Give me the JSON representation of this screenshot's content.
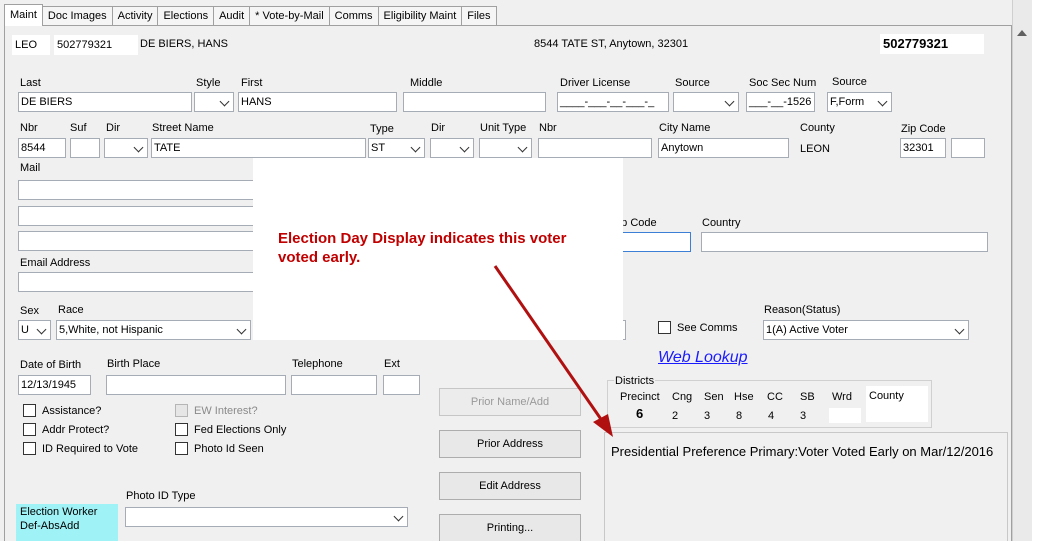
{
  "tabs": [
    "Maint",
    "Doc Images",
    "Activity",
    "Elections",
    "Audit",
    "* Vote-by-Mail",
    "Comms",
    "Eligibility Maint",
    "Files"
  ],
  "header": {
    "county_code": "LEO",
    "voter_id": "502779321",
    "name": "DE BIERS, HANS",
    "address": "8544 TATE ST, Anytown, 32301",
    "voter_id_right": "502779321"
  },
  "name_row": {
    "last_label": "Last",
    "last_value": "DE BIERS",
    "style_label": "Style",
    "style_value": "",
    "first_label": "First",
    "first_value": "HANS",
    "middle_label": "Middle",
    "middle_value": "",
    "dl_label": "Driver License",
    "dl_value": "____-___-__-___-_",
    "source_label": "Source",
    "source_value": "",
    "ssn_label": "Soc Sec Num",
    "ssn_value": "___-__-1526",
    "source2_label": "Source",
    "source2_value": "F,Form"
  },
  "addr_row": {
    "nbr_label": "Nbr",
    "nbr_value": "8544",
    "suf_label": "Suf",
    "suf_value": "",
    "dir_label": "Dir",
    "dir_value": "",
    "street_label": "Street Name",
    "street_value": "TATE",
    "type_label": "Type",
    "type_value": "ST",
    "dir2_label": "Dir",
    "dir2_value": "",
    "unit_label": "Unit Type",
    "unit_value": "",
    "nbr2_label": "Nbr",
    "nbr2_value": "",
    "city_label": "City Name",
    "city_value": "Anytown",
    "county_label": "County",
    "county_value": "LEON",
    "zip_label": "Zip Code",
    "zip_value": "32301",
    "zip_ext": ""
  },
  "mail": {
    "label": "Mail",
    "zip_label": "Zip Code",
    "country_label": "Country"
  },
  "email_label": "Email Address",
  "demo": {
    "sex_label": "Sex",
    "sex_value": "U",
    "race_label": "Race",
    "race_value": "5,White, not Hispanic",
    "see_comms": "See Comms",
    "reason_label": "Reason(Status)",
    "reason_value": "1(A) Active Voter"
  },
  "web_lookup": "Web Lookup",
  "birth": {
    "dob_label": "Date of Birth",
    "dob_value": "12/13/1945",
    "place_label": "Birth Place",
    "place_value": "",
    "tel_label": "Telephone",
    "tel_value": "",
    "ext_label": "Ext",
    "ext_value": ""
  },
  "districts": {
    "label": "Districts",
    "headers": [
      "Precinct",
      "Cng",
      "Sen",
      "Hse",
      "CC",
      "SB",
      "Wrd"
    ],
    "values": [
      "6",
      "2",
      "3",
      "8",
      "4",
      "3",
      ""
    ],
    "county_label": "County"
  },
  "checkboxes": {
    "assistance": "Assistance?",
    "addr_protect": "Addr Protect?",
    "id_required": "ID Required to Vote",
    "ew_interest": "EW Interest?",
    "fed_only": "Fed Elections Only",
    "photo_seen": "Photo Id Seen"
  },
  "buttons": {
    "prior_name": "Prior Name/Add",
    "prior_address": "Prior Address",
    "edit_address": "Edit Address",
    "printing": "Printing..."
  },
  "info_text": "Presidential Preference Primary:Voter Voted Early on Mar/12/2016",
  "photo_id_label": "Photo ID Type",
  "flags": [
    "Election Worker",
    "Def-AbsAdd"
  ],
  "callout": "Election Day Display indicates this voter voted early.",
  "colors": {
    "callout": "#c00000",
    "arrow": "#b01010",
    "link": "#1a1aff",
    "flag_bg": "#9ff3f7"
  }
}
